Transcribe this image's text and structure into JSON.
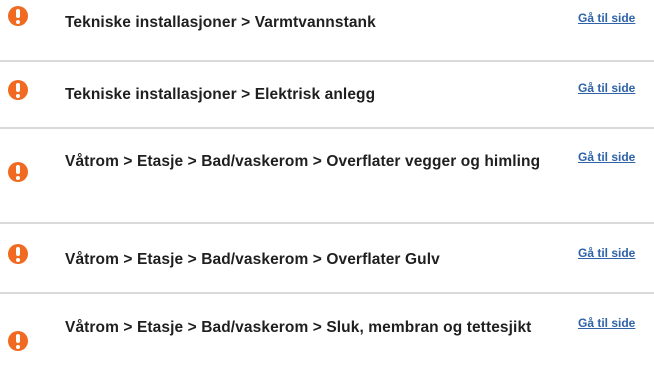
{
  "items": [
    {
      "path": "Tekniske installasjoner > Varmtvannstank",
      "link_label": "Gå til side"
    },
    {
      "path": "Tekniske installasjoner > Elektrisk anlegg",
      "link_label": "Gå til side"
    },
    {
      "path": "Våtrom > Etasje > Bad/vaskerom  > Overflater vegger og himling",
      "link_label": "Gå til side"
    },
    {
      "path": "Våtrom > Etasje > Bad/vaskerom  > Overflater Gulv",
      "link_label": "Gå til side"
    },
    {
      "path": "Våtrom > Etasje > Bad/vaskerom  > Sluk, membran og tettesjikt",
      "link_label": "Gå til side"
    }
  ],
  "icon": "exclamation-circle-icon",
  "colors": {
    "warning": "#f06a22",
    "link": "#2f63a8",
    "text": "#1f1f1f",
    "divider": "#dadada"
  }
}
